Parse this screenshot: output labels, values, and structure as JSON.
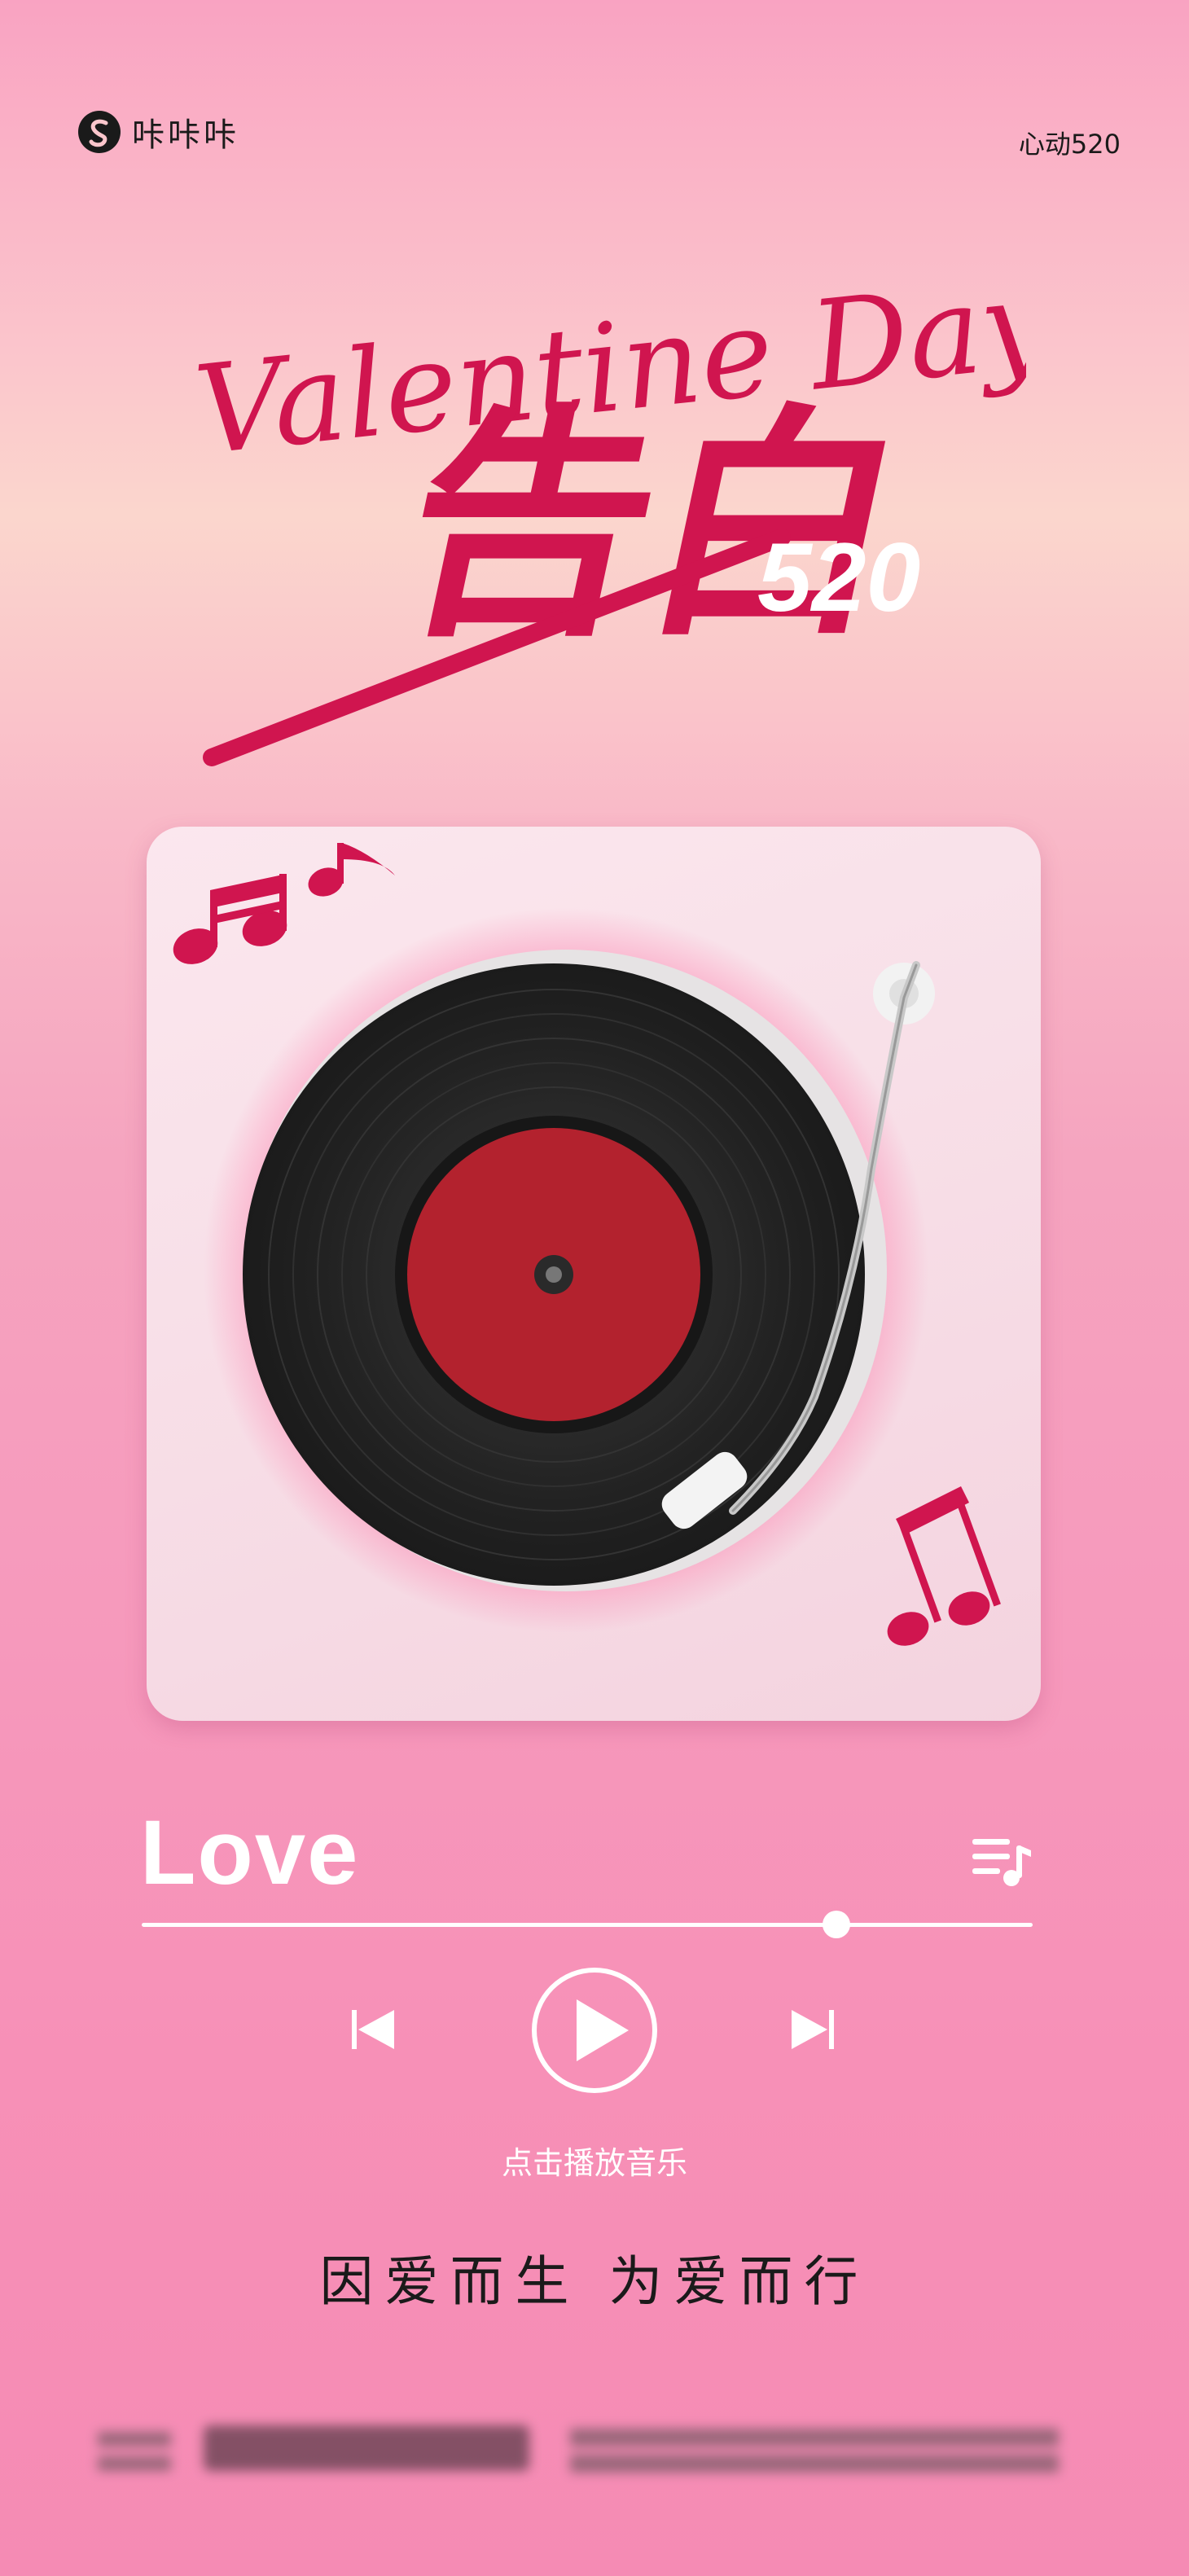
{
  "header": {
    "brand_name": "咔咔咔",
    "tag": "心动520"
  },
  "title": {
    "script": "Valentine Day",
    "main": "告白",
    "number": "520"
  },
  "player": {
    "song_title": "Love",
    "progress": 0.78,
    "play_hint": "点击播放音乐",
    "icons": [
      "music-note-icon",
      "playlist-icon",
      "previous-icon",
      "play-icon",
      "next-icon"
    ]
  },
  "slogan": "因爱而生 为爱而行",
  "colors": {
    "accent": "#d0154f",
    "label_red": "#b3222e",
    "record": "#242424",
    "background_pink": "#f69bbd"
  }
}
